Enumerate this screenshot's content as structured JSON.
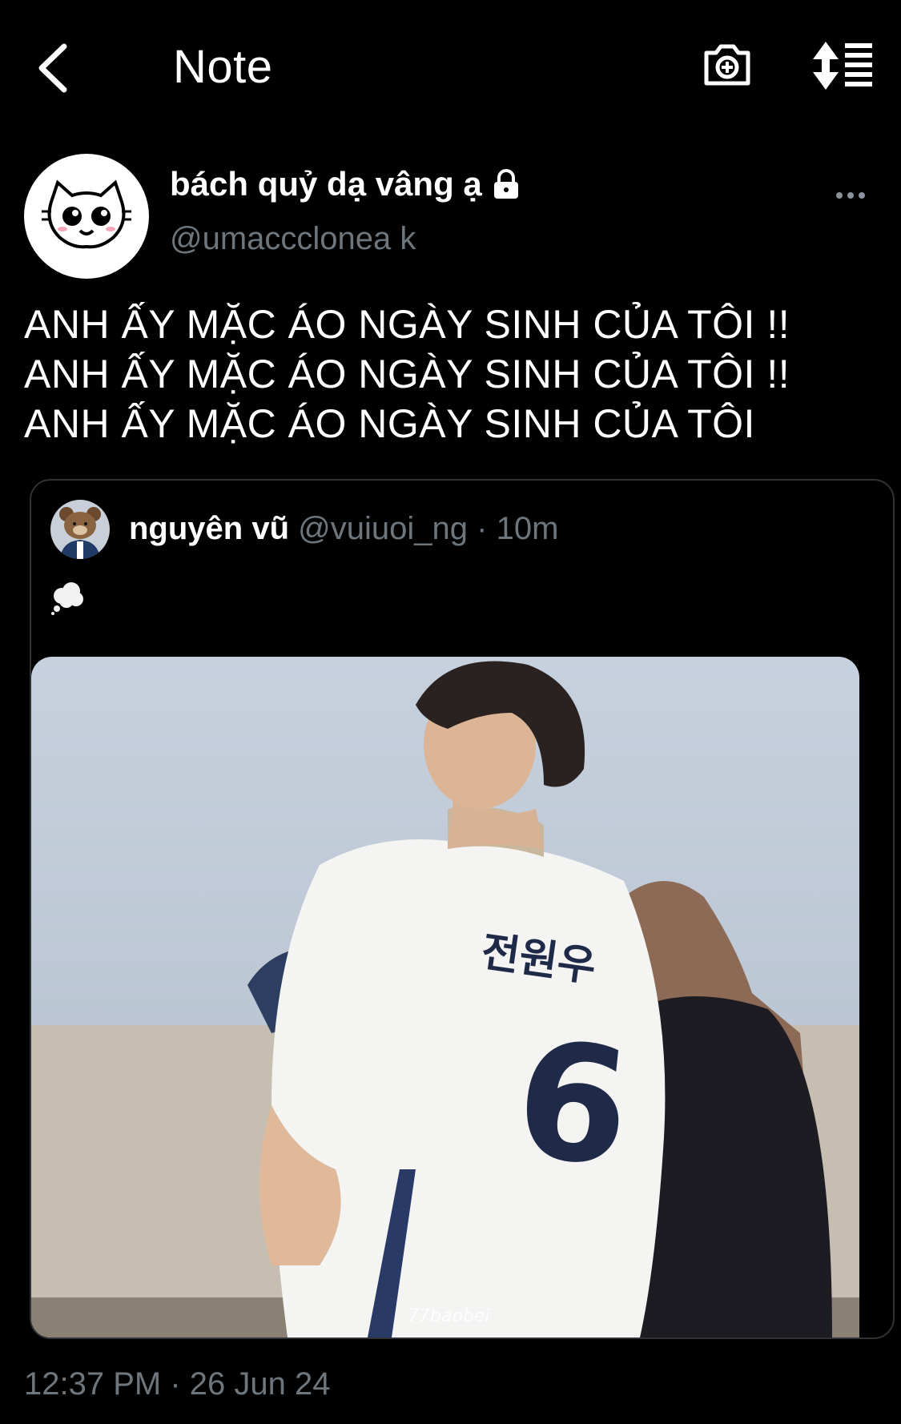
{
  "header": {
    "title": "Note"
  },
  "post": {
    "display_name": "bách quỷ dạ vâng ạ",
    "handle": "@umaccclonea k",
    "lines": [
      "ANH ẤY MẶC ÁO NGÀY SINH CỦA TÔI !!",
      "ANH ẤY MẶC ÁO NGÀY SINH CỦA TÔI !!",
      "ANH ẤY MẶC ÁO NGÀY SINH CỦA TÔI"
    ],
    "timestamp": "12:37 PM · 26 Jun 24"
  },
  "quote": {
    "display_name": "nguyên vũ",
    "handle": "@vuiuoi_ng",
    "separator": "·",
    "time": "10m",
    "image_jersey_name": "전원우",
    "image_jersey_number": "6",
    "image_watermark": "77baobei"
  },
  "colors": {
    "background": "#000000",
    "text": "#ffffff",
    "muted": "#6e767d",
    "border": "#2f3336"
  },
  "icons": [
    "back-arrow-icon",
    "camera-add-icon",
    "sort-icon",
    "lock-icon",
    "more-icon",
    "thought-bubble-icon"
  ]
}
